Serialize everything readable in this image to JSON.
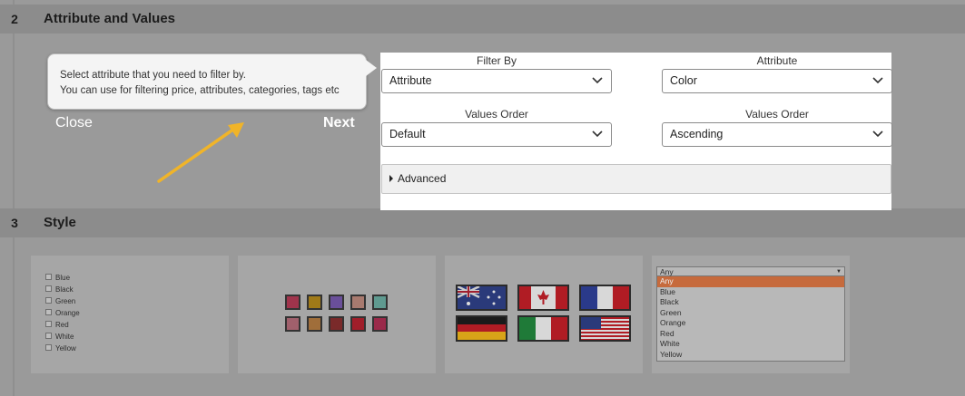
{
  "steps": [
    {
      "number": "2",
      "title": "Attribute and Values"
    },
    {
      "number": "3",
      "title": "Style"
    }
  ],
  "tooltip": {
    "line1": "Select attribute that you need to filter by.",
    "line2": "You can use for filtering price, attributes, categories, tags etc",
    "close_label": "Close",
    "next_label": "Next"
  },
  "filter_panel": {
    "filter_by": {
      "label": "Filter By",
      "value": "Attribute"
    },
    "attribute": {
      "label": "Attribute",
      "value": "Color"
    },
    "values_order_left": {
      "label": "Values Order",
      "value": "Default"
    },
    "values_order_right": {
      "label": "Values Order",
      "value": "Ascending"
    },
    "advanced_label": "Advanced"
  },
  "style_checkbox": {
    "items": [
      "Blue",
      "Black",
      "Green",
      "Orange",
      "Red",
      "White",
      "Yellow"
    ]
  },
  "style_color_swatches": [
    "#a0344c",
    "#a07a18",
    "#6a4f9a",
    "#a87a6f",
    "#5f9a90",
    "#a0606c",
    "#a06e3a",
    "#7a2a2a",
    "#a01e2a",
    "#9a2a4a"
  ],
  "style_flags": [
    "australia",
    "canada",
    "france",
    "germany",
    "italy",
    "usa"
  ],
  "style_select": {
    "current": "Any",
    "options": [
      "Any",
      "Blue",
      "Black",
      "Green",
      "Orange",
      "Red",
      "White",
      "Yellow"
    ],
    "highlighted": "Any"
  },
  "colors": {
    "overlay_gray": "#9a9a9a",
    "header_gray": "#8c8c8c",
    "arrow": "#f0b429",
    "select_highlight": "#c66a3c"
  }
}
